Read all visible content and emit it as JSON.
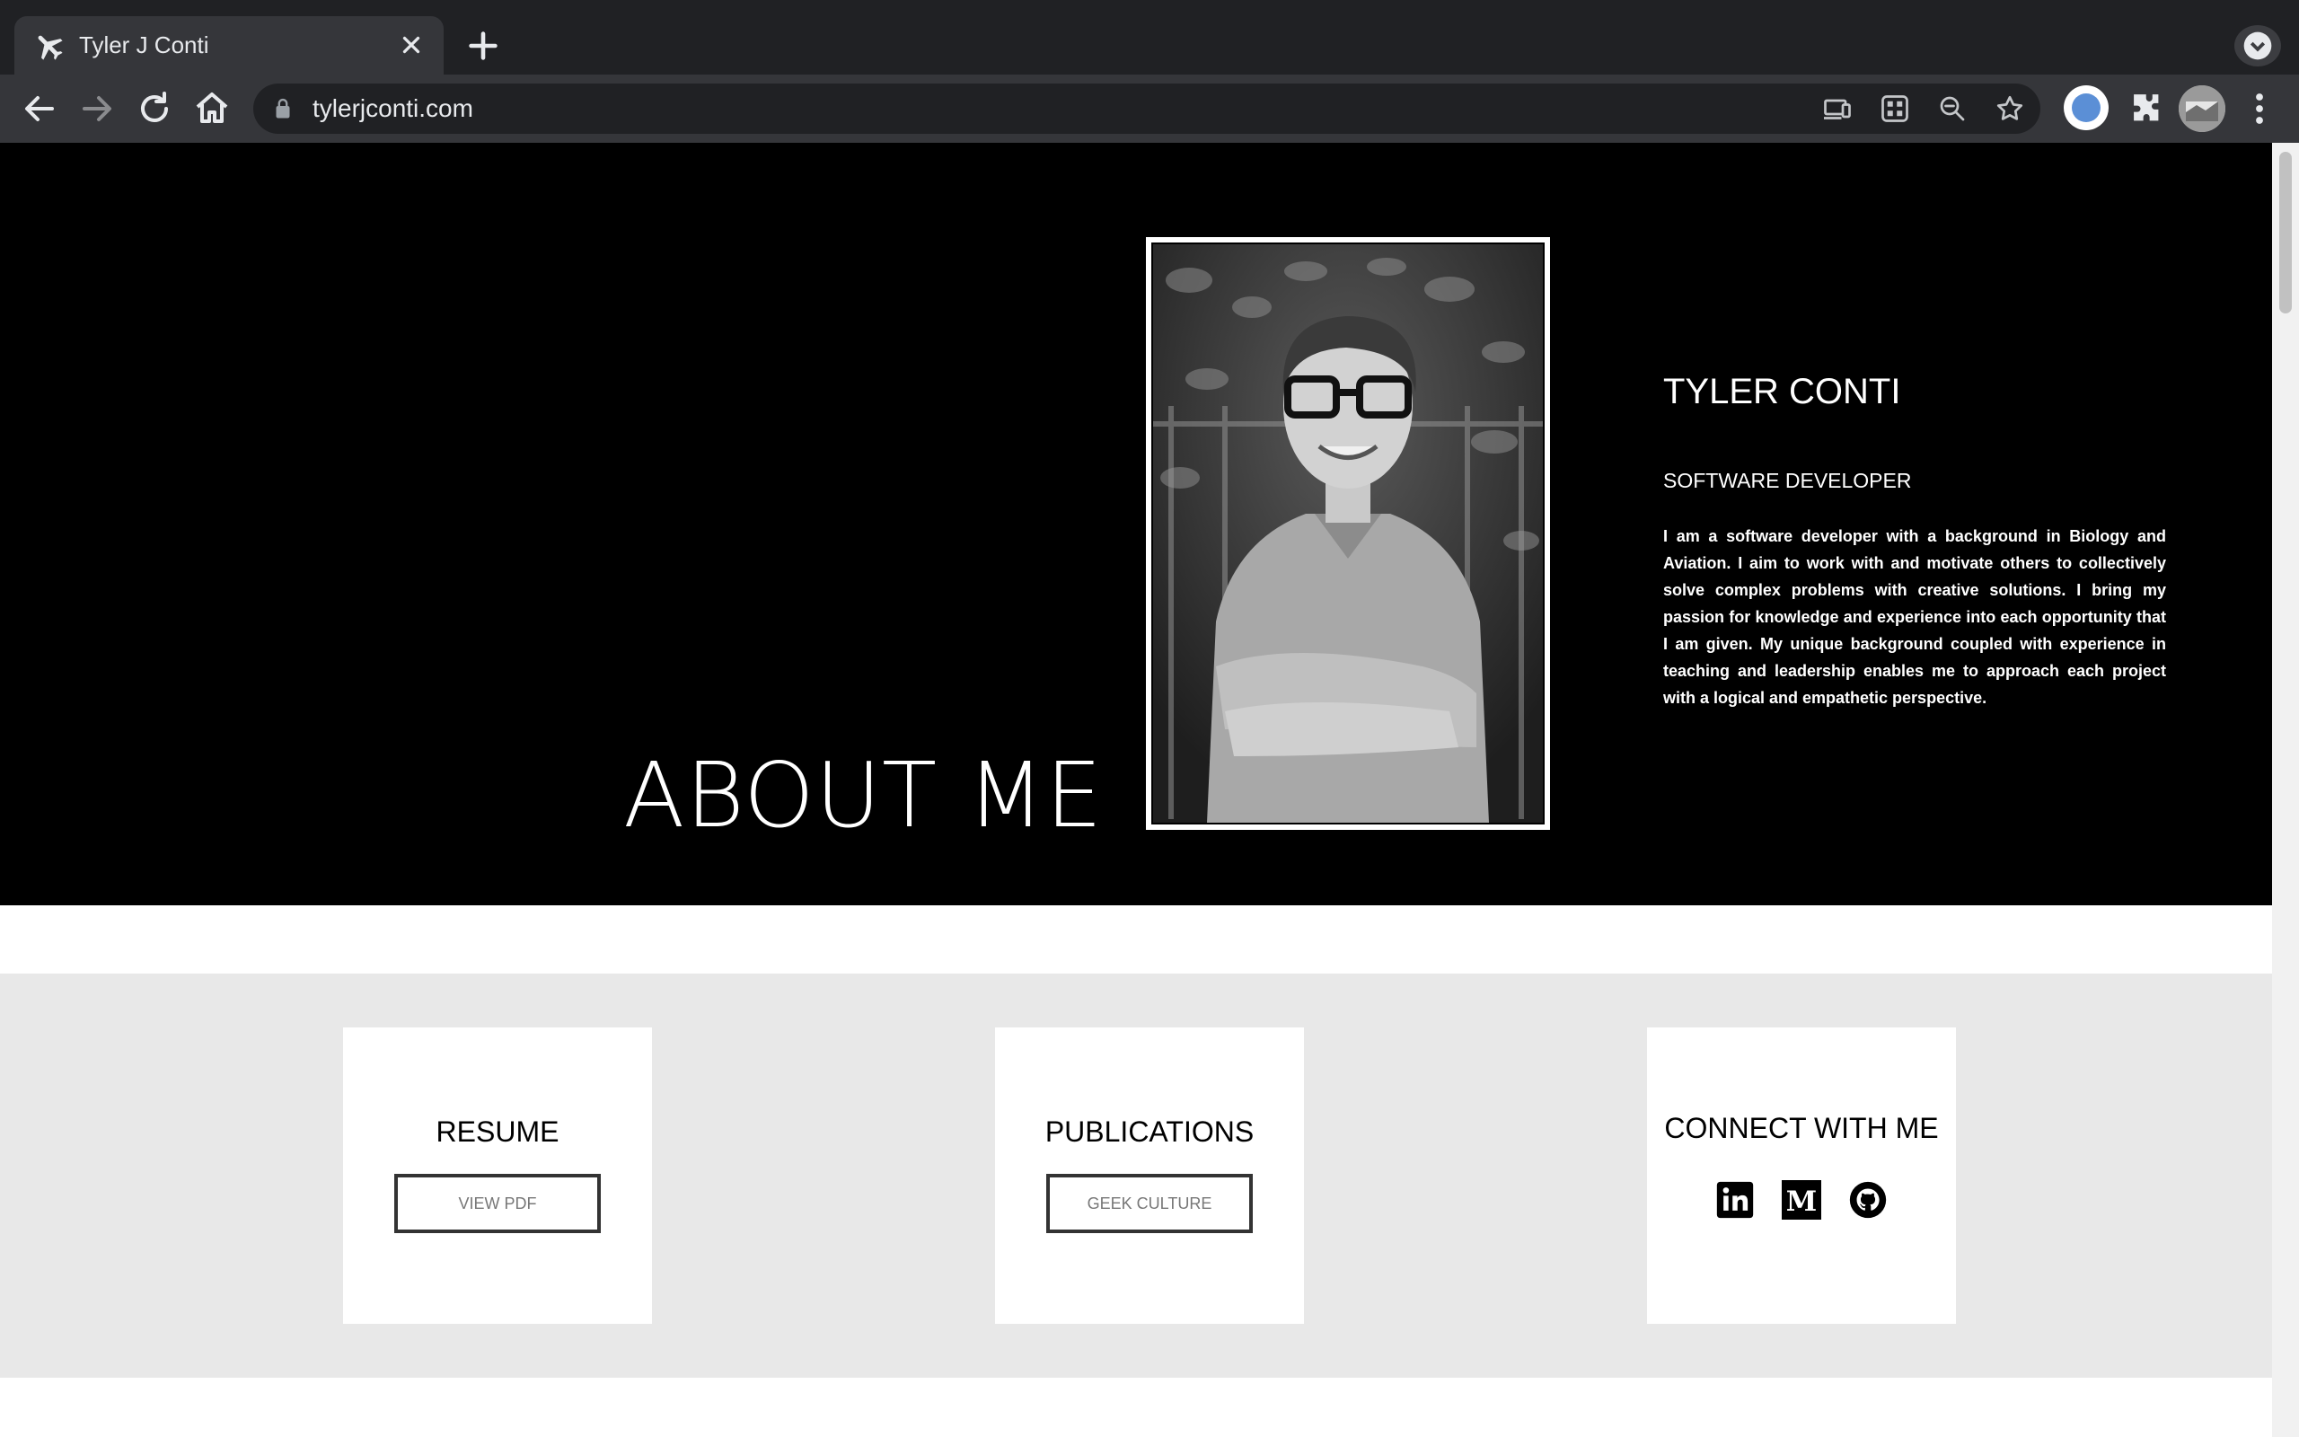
{
  "browser": {
    "tab_title": "Tyler J Conti",
    "url": "tylerjconti.com"
  },
  "hero": {
    "heading": "ABOUT ME",
    "name": "TYLER CONTI",
    "role": "SOFTWARE DEVELOPER",
    "bio": "I am a software developer with a background in Biology and Aviation. I aim to work with and motivate others to collectively solve complex problems with creative solutions. I bring my passion for knowledge and experience into each opportunity that I am given. My unique background coupled with experience in teaching and leadership enables me to approach each project with a logical and empathetic perspective."
  },
  "cards": {
    "resume": {
      "title": "RESUME",
      "button": "VIEW PDF"
    },
    "publications": {
      "title": "PUBLICATIONS",
      "button": "GEEK CULTURE"
    },
    "connect": {
      "title": "CONNECT WITH ME",
      "icons": [
        "linkedin-icon",
        "medium-icon",
        "github-icon"
      ]
    }
  },
  "colors": {
    "hero_bg": "#000000",
    "band_bg": "#e8e8e8",
    "chrome_dark": "#202124",
    "chrome_toolbar": "#35363a"
  }
}
